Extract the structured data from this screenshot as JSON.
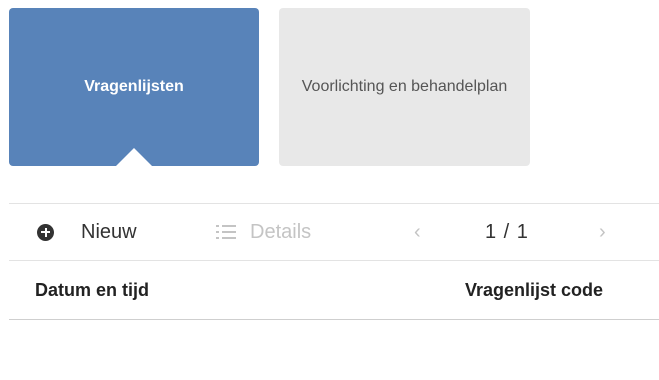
{
  "tabs": [
    {
      "label": "Vragenlijsten",
      "active": true
    },
    {
      "label": "Voorlichting en behandelplan",
      "active": false
    }
  ],
  "toolbar": {
    "new_label": "Nieuw",
    "new_icon": "plus-circle-icon",
    "details_label": "Details",
    "details_icon": "list-icon",
    "prev_glyph": "‹",
    "next_glyph": "›",
    "pagination": "1 / 1"
  },
  "table": {
    "columns": [
      "Datum en tijd",
      "Vragenlijst code"
    ]
  },
  "colors": {
    "active_tab": "#5883b9",
    "inactive_tab": "#e8e8e8",
    "disabled_text": "#c4c4c4"
  }
}
